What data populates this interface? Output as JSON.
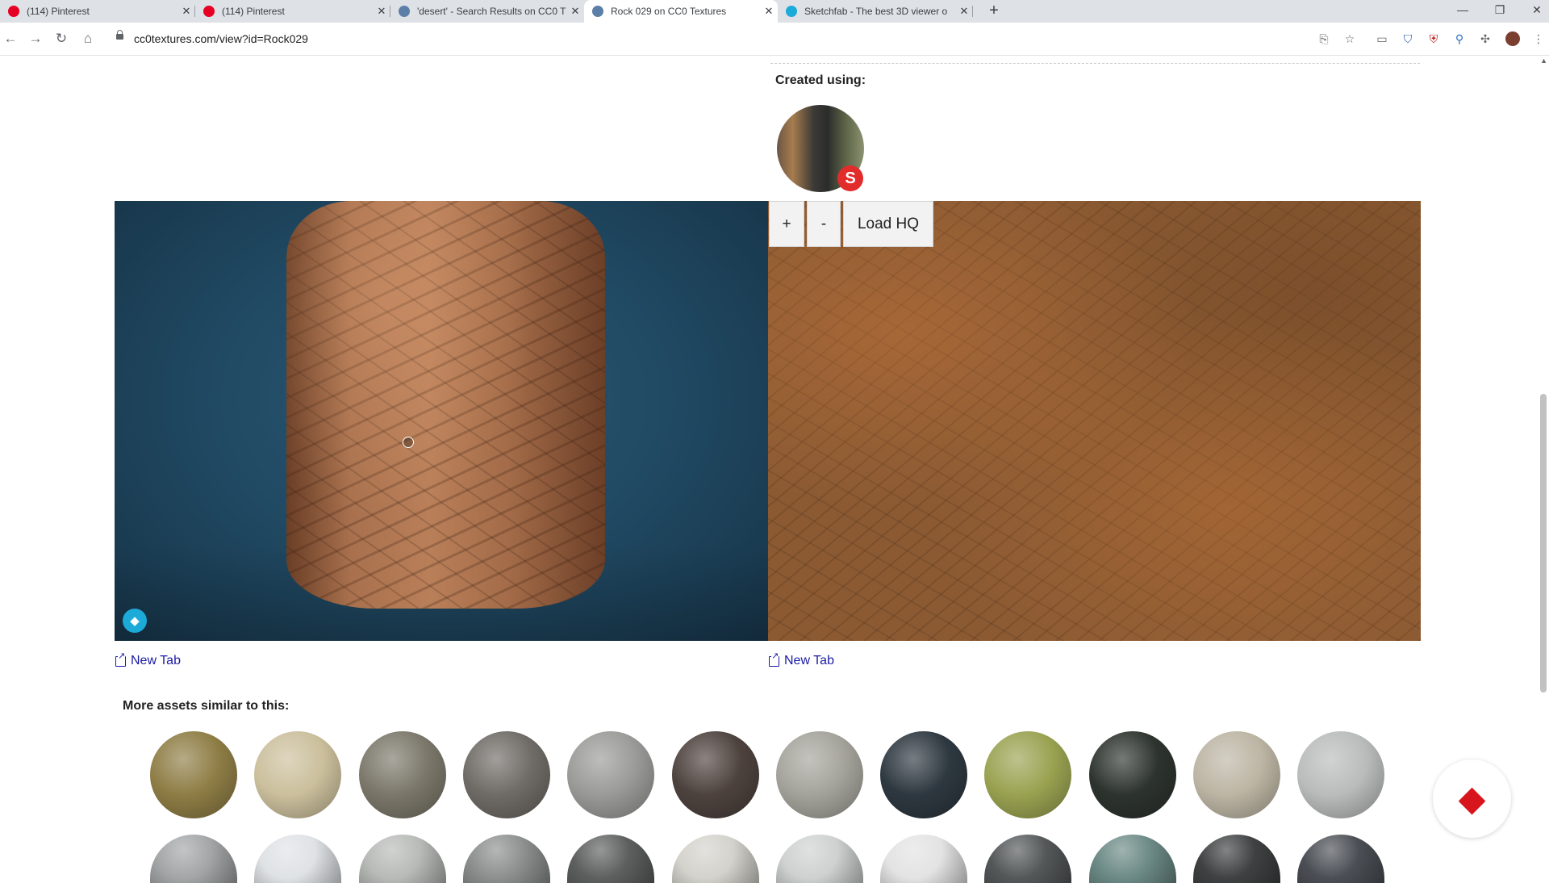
{
  "browser": {
    "tabs": [
      {
        "title": "(114) Pinterest",
        "icon": "pinterest-icon",
        "color": "#e60023"
      },
      {
        "title": "(114) Pinterest",
        "icon": "pinterest-icon",
        "color": "#e60023"
      },
      {
        "title": "'desert' - Search Results on CC0 T",
        "icon": "globe-icon",
        "color": "#5b7fa6"
      },
      {
        "title": "Rock 029 on CC0 Textures",
        "icon": "globe-icon",
        "color": "#5b7fa6"
      },
      {
        "title": "Sketchfab - The best 3D viewer o",
        "icon": "sketchfab-icon",
        "color": "#1caad9"
      }
    ],
    "active_tab": 3,
    "url": "cc0textures.com/view?id=Rock029"
  },
  "page": {
    "created_using_label": "Created using:",
    "substance_badge": "S",
    "viewer_controls": {
      "zoom_in": "+",
      "zoom_out": "-",
      "load_hq": "Load HQ"
    },
    "new_tab_left": "New Tab",
    "new_tab_right": "New Tab",
    "similar_label": "More assets similar to this:"
  },
  "similar_assets": {
    "row1": [
      "#8e7d45",
      "#cbbf9c",
      "#7b776a",
      "#6f6b66",
      "#9a9a98",
      "#4d423e",
      "#a4a39b",
      "#2e3840",
      "#9aa251",
      "#2d332e",
      "#bcb5a4",
      "#b9bcba"
    ],
    "row2": [
      "#a3a5a6",
      "#dfe2e5",
      "#b8bab8",
      "#8d8f8f",
      "#5e5f5f",
      "#d3d2cc",
      "#cfd1d1",
      "#e2e3e2",
      "#545859",
      "#6c8a86",
      "#3f4142",
      "#4b4f55"
    ]
  },
  "colors": {
    "link": "#1a1aa6",
    "brand_red": "#d8151c",
    "sketchfab": "#1caad9"
  }
}
